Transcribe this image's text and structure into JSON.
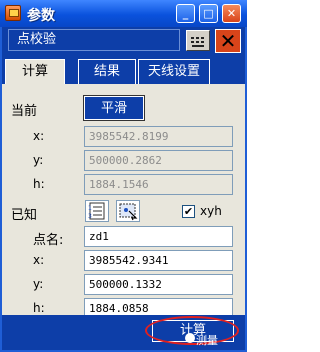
{
  "window": {
    "title": "参数",
    "app_icon": "app-icon",
    "buttons": [
      "minimize-icon",
      "maximize-icon",
      "close-icon"
    ]
  },
  "header": {
    "menu_label": "点校验",
    "keyboard_icon": "keyboard-icon",
    "close_icon": "close-icon"
  },
  "tabs": [
    {
      "label": "计算",
      "active": true
    },
    {
      "label": "结果",
      "active": false
    },
    {
      "label": "天线设置",
      "active": false
    }
  ],
  "current": {
    "label": "当前",
    "smooth_button": "平滑",
    "x_label": "x:",
    "x_value": "3985542.8199",
    "y_label": "y:",
    "y_value": "500000.2862",
    "h_label": "h:",
    "h_value": "1884.1546"
  },
  "known": {
    "label": "已知",
    "xyh_label": "xyh",
    "xyh_checked": true,
    "point_label": "点名:",
    "point_value": "zd1",
    "x_label": "x:",
    "x_value": "3985542.9341",
    "y_label": "y:",
    "y_value": "500000.1332",
    "h_label": "h:",
    "h_value": "1884.0858"
  },
  "footer": {
    "calc_button": "计算",
    "watermark": "测量"
  },
  "colors": {
    "bar_blue": "#0d3ea8",
    "highlight_red": "#e02020"
  }
}
